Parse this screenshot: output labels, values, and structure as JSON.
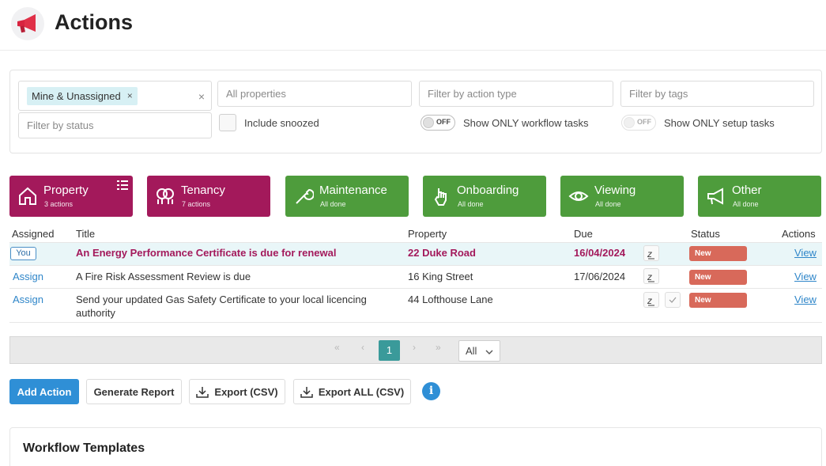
{
  "page": {
    "title": "Actions"
  },
  "filters": {
    "assigned_chip": "Mine & Unassigned",
    "chip_remove": "×",
    "clear": "×",
    "properties_placeholder": "All properties",
    "action_type_placeholder": "Filter by action type",
    "tags_placeholder": "Filter by tags",
    "status_placeholder": "Filter by status",
    "include_snoozed_label": "Include snoozed",
    "workflow_toggle_state": "OFF",
    "workflow_toggle_label": "Show ONLY workflow tasks",
    "setup_toggle_state": "OFF",
    "setup_toggle_label": "Show ONLY setup tasks"
  },
  "categories": [
    {
      "name": "Property",
      "sub": "3 actions",
      "icon": "house-icon",
      "color": "#a3195b"
    },
    {
      "name": "Tenancy",
      "sub": "7 actions",
      "icon": "people-icon",
      "color": "#a3195b"
    },
    {
      "name": "Maintenance",
      "sub": "All done",
      "icon": "wrench-icon",
      "color": "#4e9c3c"
    },
    {
      "name": "Onboarding",
      "sub": "All done",
      "icon": "pointer-hand-icon",
      "color": "#4e9c3c"
    },
    {
      "name": "Viewing",
      "sub": "All done",
      "icon": "eye-icon",
      "color": "#4e9c3c"
    },
    {
      "name": "Other",
      "sub": "All done",
      "icon": "megaphone-icon",
      "color": "#4e9c3c"
    }
  ],
  "table": {
    "headers": {
      "assigned": "Assigned",
      "title": "Title",
      "property": "Property",
      "due": "Due",
      "status": "Status",
      "actions": "Actions"
    },
    "rows": [
      {
        "assigned": "You",
        "title": "An Energy Performance Certificate is due for renewal",
        "property": "22 Duke Road",
        "due": "16/04/2024",
        "status": "New",
        "action": "View"
      },
      {
        "assigned": "Assign",
        "title": "A Fire Risk Assessment Review is due",
        "property": "16 King Street",
        "due": "17/06/2024",
        "status": "New",
        "action": "View"
      },
      {
        "assigned": "Assign",
        "title_line1": "Send your updated Gas Safety Certificate to your local licencing",
        "title_line2": "authority",
        "property": "44 Lofthouse Lane",
        "due": "",
        "status": "New",
        "action": "View"
      }
    ]
  },
  "pagination": {
    "first": "«",
    "prev": "‹",
    "current": "1",
    "next": "›",
    "last": "»",
    "page_size": "All"
  },
  "toolbar": {
    "add_action": "Add Action",
    "generate_report": "Generate Report",
    "export_csv": "Export (CSV)",
    "export_all_csv": "Export ALL (CSV)",
    "info": "i"
  },
  "workflow": {
    "title": "Workflow Templates"
  },
  "colors": {
    "accent": "#2f8fd6",
    "brand": "#a3195b",
    "green": "#4e9c3c",
    "status_new": "#d8695a",
    "teal": "#3a9a9a"
  }
}
